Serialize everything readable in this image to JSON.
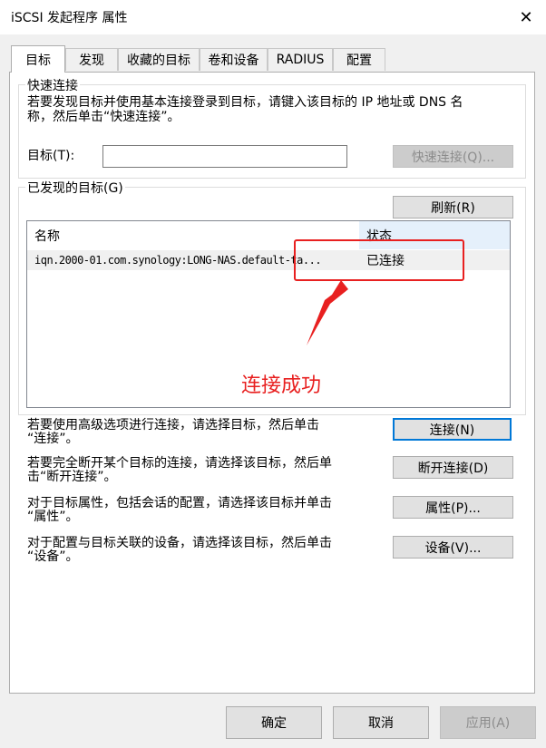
{
  "window": {
    "title": "iSCSI 发起程序 属性",
    "close_glyph": "✕"
  },
  "tabs": [
    {
      "label": "目标",
      "active": true
    },
    {
      "label": "发现",
      "active": false
    },
    {
      "label": "收藏的目标",
      "active": false
    },
    {
      "label": "卷和设备",
      "active": false
    },
    {
      "label": "RADIUS",
      "active": false
    },
    {
      "label": "配置",
      "active": false
    }
  ],
  "quick_connect": {
    "group_label": "快速连接",
    "description_line1": "若要发现目标并使用基本连接登录到目标，请键入该目标的 IP 地址或 DNS 名",
    "description_line2": "称，然后单击“快速连接”。",
    "target_label": "目标(T):",
    "target_value": "",
    "button_label": "快速连接(Q)..."
  },
  "discovered": {
    "group_label": "已发现的目标(G)",
    "refresh_label": "刷新(R)",
    "columns": [
      "名称",
      "状态"
    ],
    "rows": [
      {
        "name": "iqn.2000-01.com.synology:LONG-NAS.default-ta...",
        "status": "已连接"
      }
    ]
  },
  "actions": [
    {
      "line1": "若要使用高级选项进行连接，请选择目标，然后单击",
      "line2": "“连接”。",
      "button": "连接(N)"
    },
    {
      "line1": "若要完全断开某个目标的连接，请选择该目标，然后单",
      "line2": "击“断开连接”。",
      "button": "断开连接(D)"
    },
    {
      "line1": "对于目标属性，包括会话的配置，请选择该目标并单击",
      "line2": "“属性”。",
      "button": "属性(P)..."
    },
    {
      "line1": "对于配置与目标关联的设备，请选择该目标，然后单击",
      "line2": "“设备”。",
      "button": "设备(V)..."
    }
  ],
  "footer": {
    "ok": "确定",
    "cancel": "取消",
    "apply": "应用(A)"
  },
  "annotation": {
    "text": "连接成功",
    "color": "#e82020"
  },
  "colors": {
    "accent": "#0078d7",
    "dialog_bg": "#f0f0f0",
    "button_bg": "#e1e1e1"
  }
}
